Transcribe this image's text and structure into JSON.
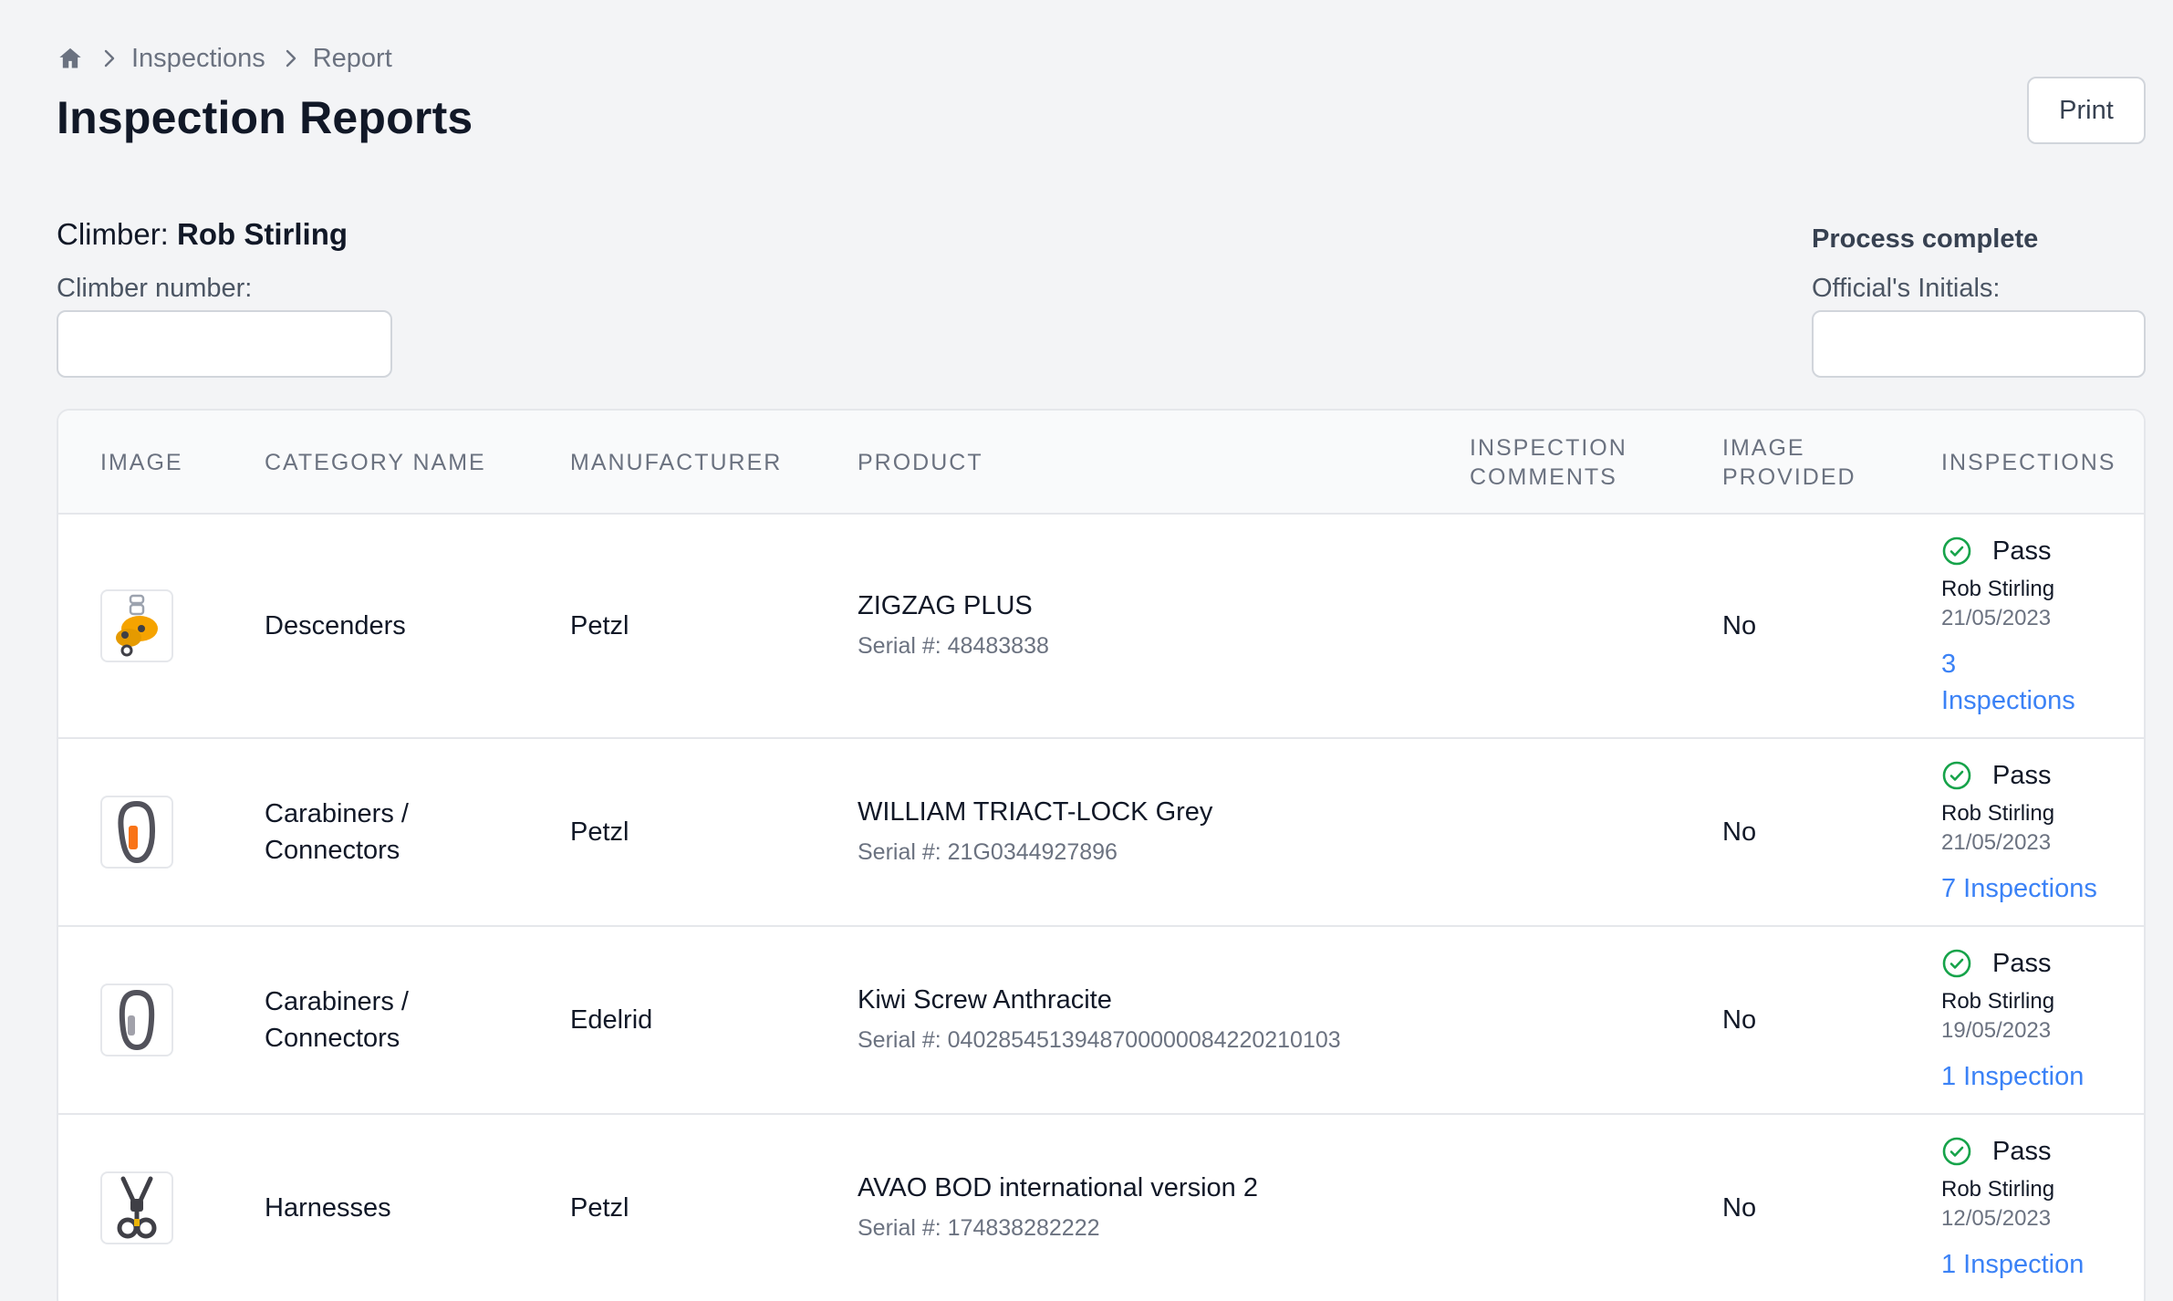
{
  "breadcrumb": {
    "home_icon": "home-icon",
    "items": [
      "Inspections",
      "Report"
    ]
  },
  "page": {
    "title": "Inspection Reports",
    "print_label": "Print"
  },
  "climber": {
    "label": "Climber:",
    "name": "Rob Stirling",
    "number_label": "Climber number:",
    "number_value": ""
  },
  "process": {
    "title": "Process complete",
    "initials_label": "Official's Initials:",
    "initials_value": ""
  },
  "table": {
    "headers": {
      "image": "IMAGE",
      "category": "CATEGORY NAME",
      "manufacturer": "MANUFACTURER",
      "product": "PRODUCT",
      "comments_1": "INSPECTION",
      "comments_2": "COMMENTS",
      "provided_1": "IMAGE",
      "provided_2": "PROVIDED",
      "inspections": "INSPECTIONS"
    },
    "serial_prefix": "Serial #: ",
    "rows": [
      {
        "category_1": "Descenders",
        "category_2": "",
        "manufacturer": "Petzl",
        "product": "ZIGZAG PLUS",
        "serial": "Serial #: 48483838",
        "comments": "",
        "image_provided": "No",
        "status": "Pass",
        "inspector": "Rob Stirling",
        "date": "21/05/2023",
        "link_1": "3",
        "link_2": "Inspections",
        "thumb_icon": "descender-icon"
      },
      {
        "category_1": "Carabiners /",
        "category_2": "Connectors",
        "manufacturer": "Petzl",
        "product": "WILLIAM TRIACT-LOCK Grey",
        "serial": "Serial #: 21G0344927896",
        "comments": "",
        "image_provided": "No",
        "status": "Pass",
        "inspector": "Rob Stirling",
        "date": "21/05/2023",
        "link_1": "7 Inspections",
        "link_2": "",
        "thumb_icon": "carabiner-orange-icon"
      },
      {
        "category_1": "Carabiners /",
        "category_2": "Connectors",
        "manufacturer": "Edelrid",
        "product": "Kiwi Screw Anthracite",
        "serial": "Serial #: 04028545139487000000842202 10103",
        "comments": "",
        "image_provided": "No",
        "status": "Pass",
        "inspector": "Rob Stirling",
        "date": "19/05/2023",
        "link_1": "1 Inspection",
        "link_2": "",
        "thumb_icon": "carabiner-grey-icon"
      },
      {
        "category_1": "Harnesses",
        "category_2": "",
        "manufacturer": "Petzl",
        "product": "AVAO BOD international version 2",
        "serial": "Serial #: 174838282222",
        "comments": "",
        "image_provided": "No",
        "status": "Pass",
        "inspector": "Rob Stirling",
        "date": "12/05/2023",
        "link_1": "1 Inspection",
        "link_2": "",
        "thumb_icon": "harness-icon"
      }
    ]
  },
  "colors": {
    "background": "#f3f4f6",
    "link": "#3b82f6",
    "pass": "#16a34a",
    "border": "#e5e7eb"
  }
}
